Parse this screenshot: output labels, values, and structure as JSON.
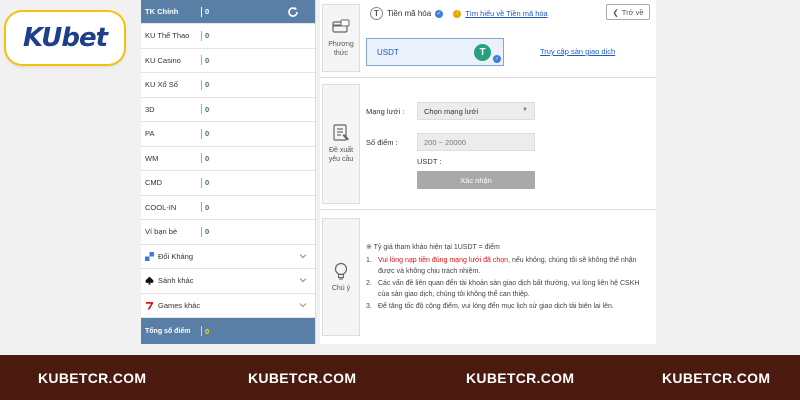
{
  "logo": {
    "part1": "KU",
    "part2": "bet"
  },
  "sidebar": {
    "header": {
      "label": "TK Chính",
      "value": "0"
    },
    "items": [
      {
        "label": "KU Thể Thao",
        "value": "0"
      },
      {
        "label": "KU Casino",
        "value": "0"
      },
      {
        "label": "KU Xổ Số",
        "value": "0"
      },
      {
        "label": "3D",
        "value": "0"
      },
      {
        "label": "PA",
        "value": "0"
      },
      {
        "label": "WM",
        "value": "0"
      },
      {
        "label": "CMD",
        "value": "0"
      },
      {
        "label": "COOL-IN",
        "value": "0"
      },
      {
        "label": "Ví bạn bè",
        "value": "0"
      }
    ],
    "categories": [
      {
        "label": "Đối Kháng",
        "icon": "chess-icon",
        "color": "#3b7dd8"
      },
      {
        "label": "Sảnh khác",
        "icon": "spade-icon",
        "color": "#111111"
      },
      {
        "label": "Games khác",
        "icon": "seven-icon",
        "color": "#e01010"
      }
    ],
    "total": {
      "label": "Tổng số điểm",
      "value": "0"
    }
  },
  "payment": {
    "section_label": "Phương thức",
    "method_title": "Tiền mã hóa",
    "learn_link": "Tìm hiểu về Tiền mã hóa",
    "back_label": "Trở về",
    "selected_coin": "USDT",
    "exchange_link": "Truy cập sàn giao dịch"
  },
  "request": {
    "section_label": "Đề xuất yêu cầu",
    "network_label": "Mạng lưới :",
    "network_value": "Chọn mạng lưới",
    "points_label": "Số điểm :",
    "points_placeholder": "200 ~ 20000",
    "usdt_label": "USDT :",
    "submit_label": "Xác nhận"
  },
  "notes": {
    "section_label": "Chú ý",
    "rate": "※ Tỷ giá tham khảo hiện tại 1USDT = điểm",
    "items": [
      {
        "num": "1.",
        "red": "Vui lòng nạp tiền đúng mạng lưới đã chọn",
        "text": ", nếu không, chúng tôi sẽ không thể nhận được và không chịu trách nhiệm."
      },
      {
        "num": "2.",
        "text": "Các vấn đề liên quan đến tài khoản sàn giao dịch bất thường, vui lòng liên hệ CSKH của sàn giao dịch, chúng tôi không thể can thiệp."
      },
      {
        "num": "3.",
        "text": "Để tăng tốc độ cộng điểm, vui lòng đến mục lịch sử giao dịch tải biên lai lên."
      }
    ]
  },
  "footer": {
    "items": [
      "KUBETCR.COM",
      "KUBETCR.COM",
      "KUBETCR.COM",
      "KUBETCR.COM"
    ]
  },
  "colors": {
    "sidebar_head": "#5a7fa7",
    "footer_bg": "#4a1a0e",
    "accent_blue": "#1d5bbf",
    "tether_green": "#26a17b"
  }
}
